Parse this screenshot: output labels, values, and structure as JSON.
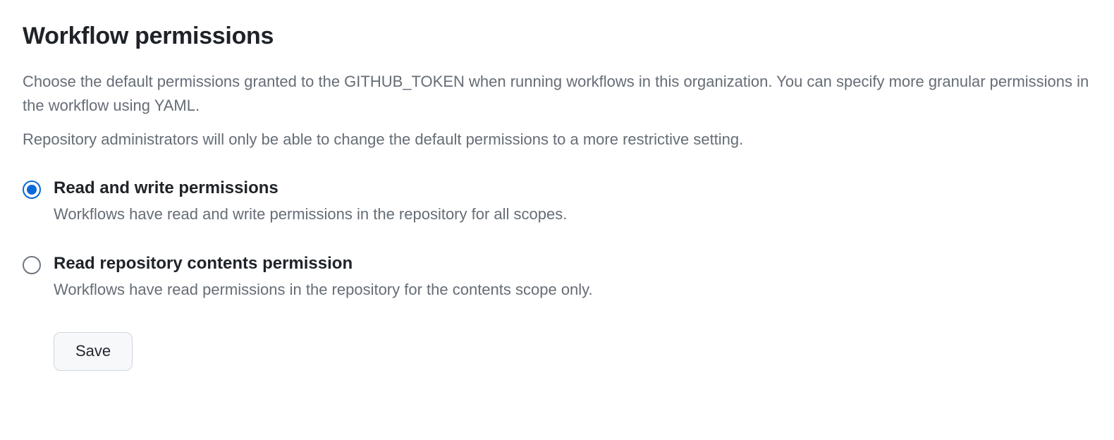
{
  "section": {
    "title": "Workflow permissions",
    "description1": "Choose the default permissions granted to the GITHUB_TOKEN when running workflows in this organization. You can specify more granular permissions in the workflow using YAML.",
    "description2": "Repository administrators will only be able to change the default permissions to a more restrictive setting."
  },
  "options": [
    {
      "label": "Read and write permissions",
      "description": "Workflows have read and write permissions in the repository for all scopes.",
      "selected": true
    },
    {
      "label": "Read repository contents permission",
      "description": "Workflows have read permissions in the repository for the contents scope only.",
      "selected": false
    }
  ],
  "actions": {
    "save_label": "Save"
  }
}
